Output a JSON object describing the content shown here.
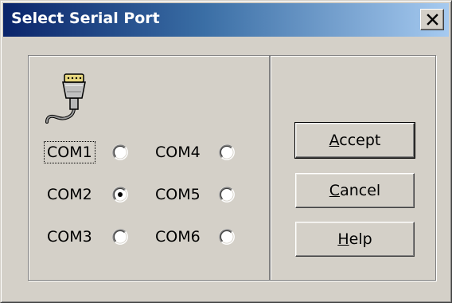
{
  "window": {
    "title": "Select Serial Port"
  },
  "icons": {
    "close": "close-icon",
    "connector": "serial-connector-icon"
  },
  "ports": [
    {
      "label": "COM1",
      "selected": false,
      "focused": true
    },
    {
      "label": "COM2",
      "selected": true,
      "focused": false
    },
    {
      "label": "COM3",
      "selected": false,
      "focused": false
    },
    {
      "label": "COM4",
      "selected": false,
      "focused": false
    },
    {
      "label": "COM5",
      "selected": false,
      "focused": false
    },
    {
      "label": "COM6",
      "selected": false,
      "focused": false
    }
  ],
  "buttons": {
    "accept": {
      "mnemonic": "A",
      "rest": "ccept"
    },
    "cancel": {
      "mnemonic": "C",
      "rest": "ancel"
    },
    "help": {
      "mnemonic": "H",
      "rest": "elp"
    }
  },
  "colors": {
    "dialog_background": "#d4d0c8",
    "titlebar_start": "#0a246a",
    "titlebar_end": "#a6caf0",
    "title_text": "#ffffff"
  }
}
